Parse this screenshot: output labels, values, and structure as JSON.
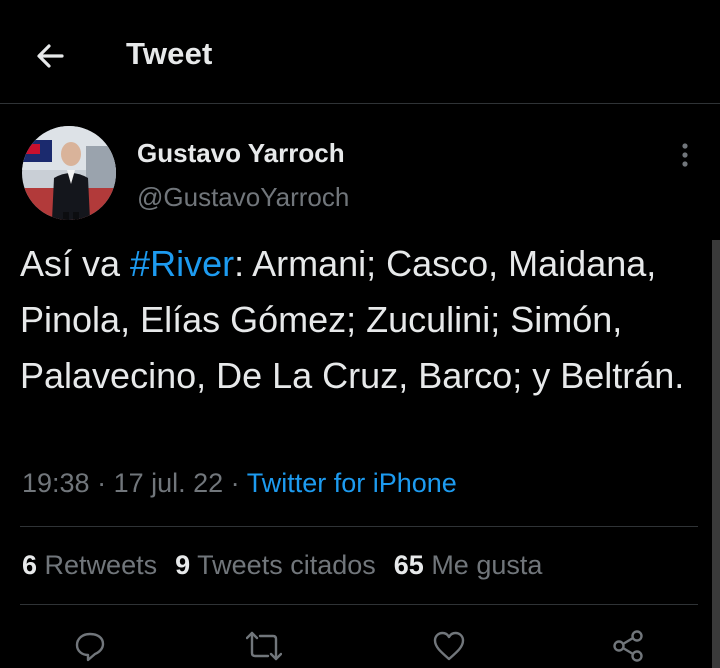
{
  "header": {
    "back_icon": "arrow-left-icon",
    "title": "Tweet"
  },
  "tweet": {
    "author": {
      "name": "Gustavo Yarroch",
      "handle": "@GustavoYarroch"
    },
    "text": {
      "prefix": "Así va ",
      "hashtag": "#River",
      "body": ": Armani; Casco, Maidana, Pinola, Elías Gómez; Zuculini; Simón, Palavecino, De La Cruz, Barco; y Beltrán."
    },
    "meta": {
      "time": "19:38",
      "separator": " · ",
      "date": "17 jul. 22",
      "source": "Twitter for iPhone"
    },
    "stats": {
      "retweets_count": "6",
      "retweets_label": "Retweets",
      "quotes_count": "9",
      "quotes_label": "Tweets citados",
      "likes_count": "65",
      "likes_label": "Me gusta"
    },
    "actions": [
      "reply-icon",
      "retweet-icon",
      "like-icon",
      "share-icon"
    ]
  },
  "colors": {
    "background": "#000000",
    "text": "#e7e9ea",
    "muted": "#71767b",
    "accent": "#1d9bf0",
    "divider": "#2f3336"
  }
}
